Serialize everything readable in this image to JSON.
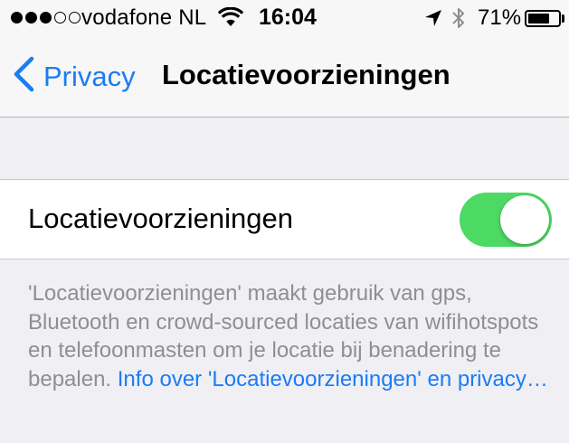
{
  "status_bar": {
    "signal_dots_full": 3,
    "signal_dots_total": 5,
    "carrier": "vodafone NL",
    "wifi_icon": "wifi-icon",
    "time": "16:04",
    "location_icon": "location-arrow-icon",
    "bluetooth_icon": "bluetooth-icon",
    "battery_percent_label": "71%",
    "battery_level": 0.71
  },
  "nav": {
    "back_label": "Privacy",
    "title": "Locatievoorzieningen"
  },
  "setting": {
    "label": "Locatievoorzieningen",
    "toggle_on": true,
    "toggle_color": "#4cd964"
  },
  "footer": {
    "text": "'Locatievoorzieningen' maakt gebruik van gps, Bluetooth en crowd-sourced locaties van wifihotspots en telefoonmasten om je locatie bij benadering te bepalen. ",
    "link": "Info over 'Locatievoorzieningen' en privacy…"
  },
  "colors": {
    "accent": "#1a7cf5",
    "background": "#efeff4",
    "footer_text": "#8e8e93"
  }
}
